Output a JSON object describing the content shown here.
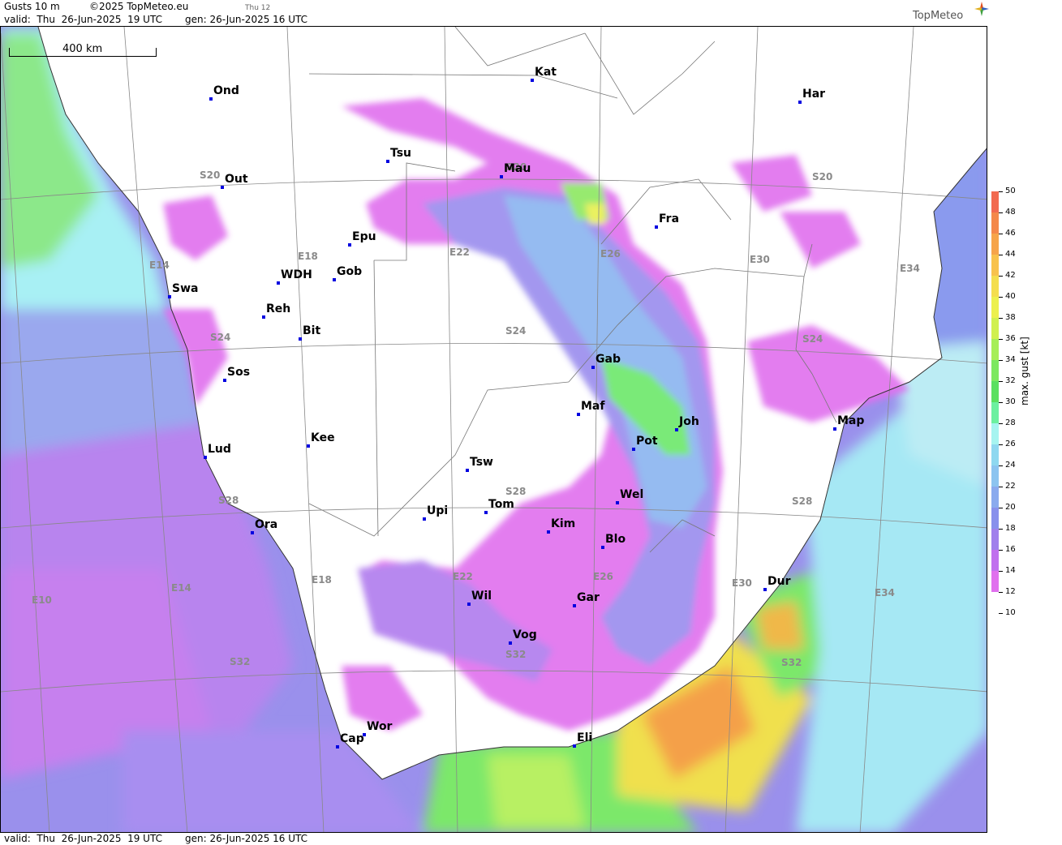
{
  "header": {
    "product": "Gusts 10 m",
    "copyright": "©2025 TopMeteo.eu",
    "step_label": "Thu 12",
    "valid": "valid:  Thu  26-Jun-2025  19 UTC",
    "gen": "gen: 26-Jun-2025 16 UTC",
    "logo_text": "TopMeteo"
  },
  "footer": {
    "valid": "valid:  Thu  26-Jun-2025  19 UTC",
    "gen": "gen: 26-Jun-2025 16 UTC"
  },
  "scale_bar": "400 km",
  "cities": [
    "Ond",
    "Kat",
    "Har",
    "Tsu",
    "Mau",
    "S20",
    "Out",
    "Fra",
    "Epu",
    "Gob",
    "WDH",
    "Swa",
    "Reh",
    "Bit",
    "Gab",
    "Sos",
    "Maf",
    "Joh",
    "Map",
    "Kee",
    "Pot",
    "Lud",
    "Tsw",
    "Wel",
    "Upi",
    "Tom",
    "Kim",
    "Ora",
    "Blo",
    "Dur",
    "Wil",
    "Gar",
    "Vog",
    "Wor",
    "Cap",
    "Eli"
  ],
  "grid_labels": [
    "S20",
    "S20",
    "S20",
    "S24",
    "S24",
    "S24",
    "S28",
    "S28",
    "S28",
    "S32",
    "S32",
    "S32",
    "E14",
    "E14",
    "E10",
    "E18",
    "E18",
    "E22",
    "E22",
    "E26",
    "E26",
    "E30",
    "E30",
    "E34",
    "E34"
  ],
  "legend": {
    "title": "max. gust  [kt]",
    "labels": [
      "50",
      "48",
      "46",
      "44",
      "42",
      "40",
      "38",
      "36",
      "34",
      "32",
      "30",
      "28",
      "26",
      "24",
      "22",
      "20",
      "18",
      "16",
      "14",
      "12",
      "10"
    ],
    "colors": [
      "#f26a50",
      "#f4884a",
      "#f6a44a",
      "#f8c24c",
      "#f4de4e",
      "#ecf04e",
      "#d0f050",
      "#a6ee58",
      "#7ce860",
      "#5ae060",
      "#6cf0a0",
      "#a6f4f0",
      "#8fd8f0",
      "#8cc4f0",
      "#8aaaee",
      "#8890ec",
      "#a080ec",
      "#c070ee",
      "#e070ee"
    ]
  }
}
